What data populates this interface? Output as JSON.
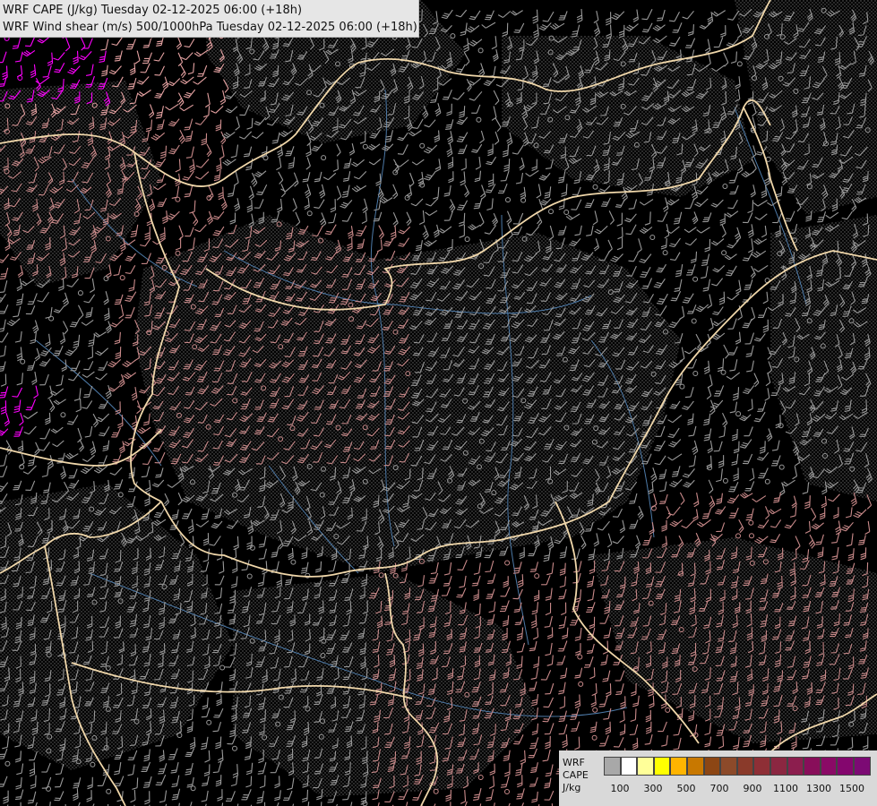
{
  "header": {
    "line1": "WRF CAPE (J/kg) Tuesday 02-12-2025 06:00 (+18h)",
    "line2": "WRF Wind shear (m/s) 500/1000hPa Tuesday 02-12-2025 06:00 (+18h)"
  },
  "legend": {
    "label_model": "WRF",
    "label_field": "CAPE",
    "label_unit": "J/kg",
    "colors": [
      "#a8a8a8",
      "#ffffff",
      "#ffff99",
      "#ffff00",
      "#ffb400",
      "#c87800",
      "#8c4614",
      "#8c4a2a",
      "#8a3a2a",
      "#8e2f36",
      "#8b2741",
      "#8c1e4e",
      "#880e5a",
      "#8a0a66",
      "#84066e",
      "#7c0a74"
    ],
    "tick_labels": [
      "100",
      "300",
      "500",
      "700",
      "900",
      "1100",
      "1300",
      "1500"
    ]
  },
  "map": {
    "background": "#000000",
    "border_color": "#f0d7aa",
    "river_color": "#4d7aa8",
    "barb_colors": [
      "#9a9a9a",
      "#c98a8a",
      "#e6a3a3",
      "#ff00ff",
      "#ffff66"
    ]
  }
}
